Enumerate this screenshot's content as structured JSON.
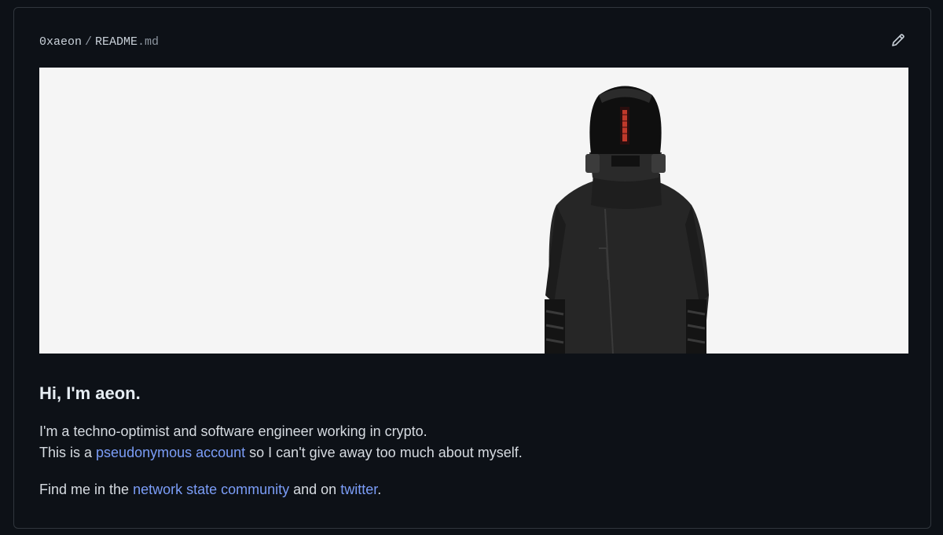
{
  "header": {
    "owner": "0xaeon",
    "separator": "/",
    "file_base": "README",
    "file_ext": ".md"
  },
  "banner": {
    "background_color": "#f5f5f5",
    "figure_icon": "masked-figure-illustration"
  },
  "readme": {
    "heading": "Hi, I'm aeon.",
    "intro_line1": "I'm a techno-optimist and software engineer working in crypto.",
    "intro_line2_pre": "This is a ",
    "intro_link": "pseudonymous account",
    "intro_line2_post": " so I can't give away too much about myself.",
    "find_pre": "Find me in the ",
    "find_link1": "network state community",
    "find_mid": " and on ",
    "find_link2": "twitter",
    "find_post": "."
  },
  "colors": {
    "page_bg": "#0d1117",
    "border": "#30363d",
    "link": "#7b9df7",
    "text": "#d6dbe1"
  }
}
